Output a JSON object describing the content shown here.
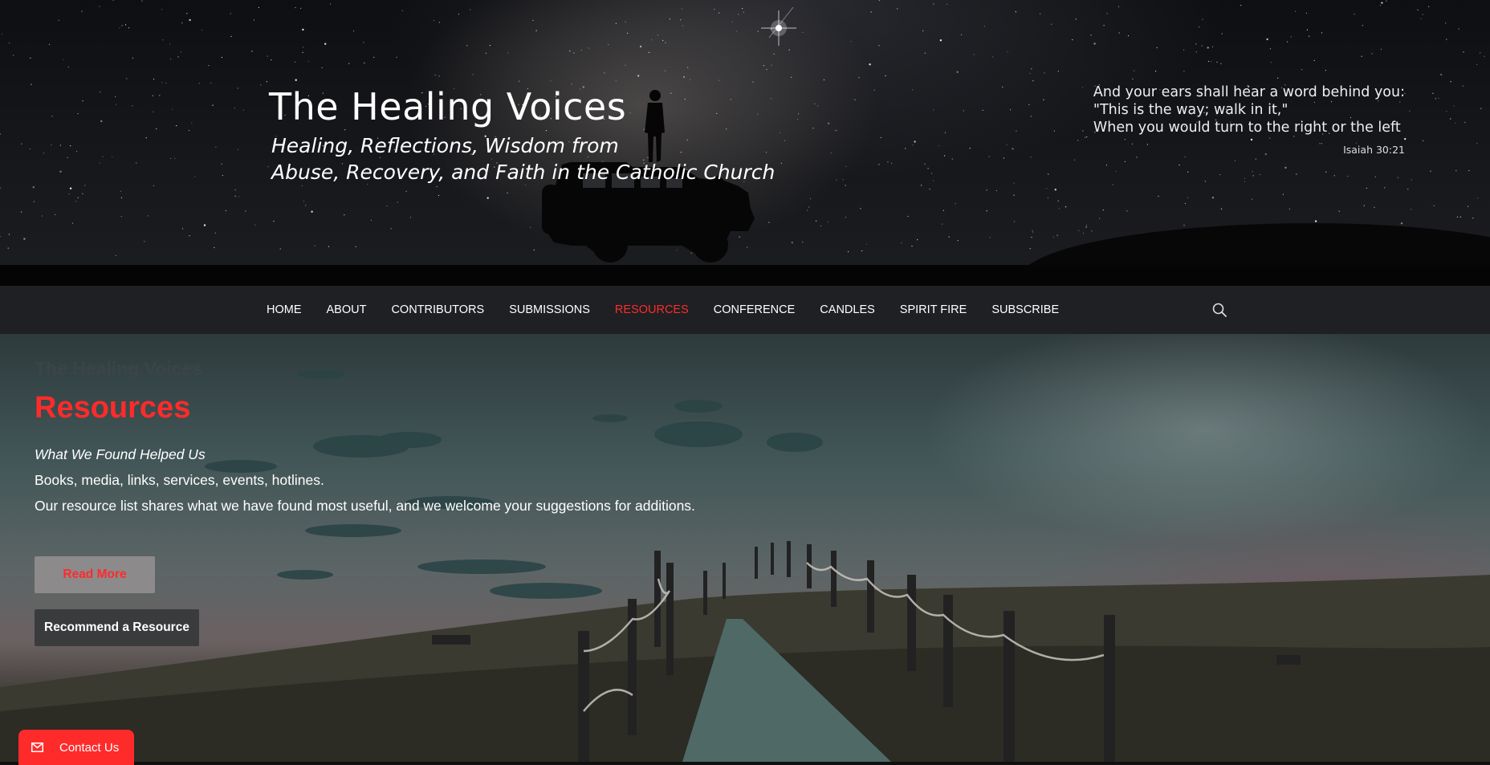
{
  "header": {
    "site_title": "The Healing Voices",
    "tagline_line1": "Healing, Reflections, Wisdom from",
    "tagline_line2": "Abuse, Recovery, and Faith in the Catholic Church",
    "verse_line1": "And your ears shall hear a word behind you:",
    "verse_line2": "\"This is the way; walk in it,\"",
    "verse_line3": "When you would turn to the right or the left",
    "verse_reference": "Isaiah 30:21"
  },
  "nav": {
    "items": [
      {
        "label": "HOME"
      },
      {
        "label": "ABOUT"
      },
      {
        "label": "CONTRIBUTORS"
      },
      {
        "label": "SUBMISSIONS"
      },
      {
        "label": "RESOURCES"
      },
      {
        "label": "CONFERENCE"
      },
      {
        "label": "CANDLES"
      },
      {
        "label": "SPIRIT FIRE"
      },
      {
        "label": "SUBSCRIBE"
      }
    ],
    "active_item": "RESOURCES",
    "search_icon": "search-icon"
  },
  "hero": {
    "site_name": "The Healing Voices",
    "title": "Resources",
    "subtitle": "What We Found Helped Us",
    "line1": "Books, media, links, services, events, hotlines.",
    "line2": "Our resource list shares what we have found most useful, and we welcome your suggestions for additions.",
    "read_more_label": "Read More",
    "recommend_label": "Recommend a Resource"
  },
  "contact": {
    "label": "Contact Us",
    "icon": "envelope-icon"
  },
  "colors": {
    "accent": "#ff2b2b",
    "nav_background": "#1e2023",
    "read_more_background": "#8d8a8b",
    "recommend_background": "#3a3b3d"
  }
}
